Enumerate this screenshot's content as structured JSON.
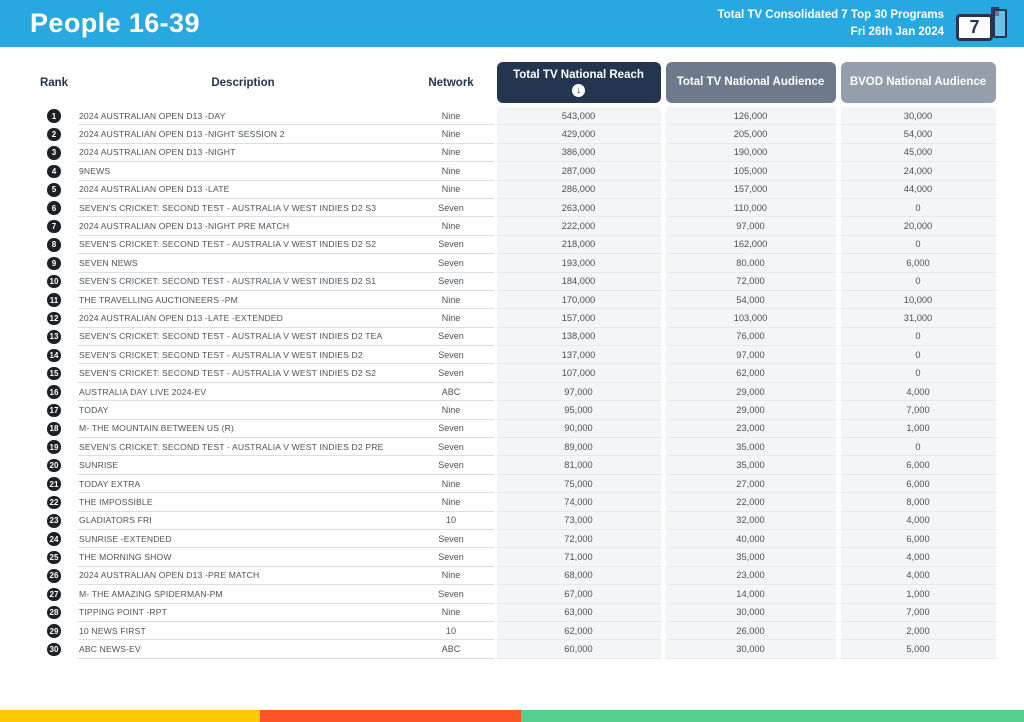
{
  "page": {
    "accent_blue": "#27A8E0",
    "navy": "#24354F"
  },
  "header": {
    "title": "People 16-39",
    "subtitle_line1": "Total TV Consolidated 7 Top 30 Programs",
    "subtitle_line2": "Fri 26th Jan 2024",
    "logo_number": "7"
  },
  "icons": {
    "sort_descending": "↓"
  },
  "table": {
    "headers": {
      "rank": "Rank",
      "description": "Description",
      "network": "Network",
      "reach": "Total TV National Reach",
      "audience": "Total TV National Audience",
      "bvod": "BVOD National Audience"
    },
    "header_colors": {
      "reach_bg": "#24354F",
      "audience_bg": "#6E7A8C",
      "bvod_bg": "#949EAC"
    },
    "rows": [
      {
        "rank": "1",
        "description": "2024 AUSTRALIAN OPEN D13 -DAY",
        "network": "Nine",
        "reach": "543,000",
        "audience": "126,000",
        "bvod": "30,000"
      },
      {
        "rank": "2",
        "description": "2024 AUSTRALIAN OPEN D13 -NIGHT SESSION 2",
        "network": "Nine",
        "reach": "429,000",
        "audience": "205,000",
        "bvod": "54,000"
      },
      {
        "rank": "3",
        "description": "2024 AUSTRALIAN OPEN D13 -NIGHT",
        "network": "Nine",
        "reach": "386,000",
        "audience": "190,000",
        "bvod": "45,000"
      },
      {
        "rank": "4",
        "description": "9NEWS",
        "network": "Nine",
        "reach": "287,000",
        "audience": "105,000",
        "bvod": "24,000"
      },
      {
        "rank": "5",
        "description": "2024 AUSTRALIAN OPEN D13 -LATE",
        "network": "Nine",
        "reach": "286,000",
        "audience": "157,000",
        "bvod": "44,000"
      },
      {
        "rank": "6",
        "description": "SEVEN'S CRICKET: SECOND TEST - AUSTRALIA V WEST INDIES D2 S3",
        "network": "Seven",
        "reach": "263,000",
        "audience": "110,000",
        "bvod": "0"
      },
      {
        "rank": "7",
        "description": "2024 AUSTRALIAN OPEN D13 -NIGHT PRE MATCH",
        "network": "Nine",
        "reach": "222,000",
        "audience": "97,000",
        "bvod": "20,000"
      },
      {
        "rank": "8",
        "description": "SEVEN'S CRICKET: SECOND TEST - AUSTRALIA V WEST INDIES D2 S2",
        "network": "Seven",
        "reach": "218,000",
        "audience": "162,000",
        "bvod": "0"
      },
      {
        "rank": "9",
        "description": "SEVEN NEWS",
        "network": "Seven",
        "reach": "193,000",
        "audience": "80,000",
        "bvod": "6,000"
      },
      {
        "rank": "10",
        "description": "SEVEN'S CRICKET: SECOND TEST - AUSTRALIA V WEST INDIES D2 S1",
        "network": "Seven",
        "reach": "184,000",
        "audience": "72,000",
        "bvod": "0"
      },
      {
        "rank": "11",
        "description": "THE TRAVELLING AUCTIONEERS -PM",
        "network": "Nine",
        "reach": "170,000",
        "audience": "54,000",
        "bvod": "10,000"
      },
      {
        "rank": "12",
        "description": "2024 AUSTRALIAN OPEN D13 -LATE -EXTENDED",
        "network": "Nine",
        "reach": "157,000",
        "audience": "103,000",
        "bvod": "31,000"
      },
      {
        "rank": "13",
        "description": "SEVEN'S CRICKET: SECOND TEST - AUSTRALIA V WEST INDIES D2 TEA",
        "network": "Seven",
        "reach": "138,000",
        "audience": "76,000",
        "bvod": "0"
      },
      {
        "rank": "14",
        "description": "SEVEN'S CRICKET: SECOND TEST - AUSTRALIA V WEST INDIES D2",
        "network": "Seven",
        "reach": "137,000",
        "audience": "97,000",
        "bvod": "0"
      },
      {
        "rank": "15",
        "description": "SEVEN'S CRICKET: SECOND TEST - AUSTRALIA V WEST INDIES D2 S2",
        "network": "Seven",
        "reach": "107,000",
        "audience": "62,000",
        "bvod": "0"
      },
      {
        "rank": "16",
        "description": "AUSTRALIA DAY LIVE 2024-EV",
        "network": "ABC",
        "reach": "97,000",
        "audience": "29,000",
        "bvod": "4,000"
      },
      {
        "rank": "17",
        "description": "TODAY",
        "network": "Nine",
        "reach": "95,000",
        "audience": "29,000",
        "bvod": "7,000"
      },
      {
        "rank": "18",
        "description": "M- THE MOUNTAIN BETWEEN US (R)",
        "network": "Seven",
        "reach": "90,000",
        "audience": "23,000",
        "bvod": "1,000"
      },
      {
        "rank": "19",
        "description": "SEVEN'S CRICKET: SECOND TEST - AUSTRALIA V WEST INDIES D2 PRE",
        "network": "Seven",
        "reach": "89,000",
        "audience": "35,000",
        "bvod": "0"
      },
      {
        "rank": "20",
        "description": "SUNRISE",
        "network": "Seven",
        "reach": "81,000",
        "audience": "35,000",
        "bvod": "6,000"
      },
      {
        "rank": "21",
        "description": "TODAY EXTRA",
        "network": "Nine",
        "reach": "75,000",
        "audience": "27,000",
        "bvod": "6,000"
      },
      {
        "rank": "22",
        "description": "THE IMPOSSIBLE",
        "network": "Nine",
        "reach": "74,000",
        "audience": "22,000",
        "bvod": "8,000"
      },
      {
        "rank": "23",
        "description": "GLADIATORS FRI",
        "network": "10",
        "reach": "73,000",
        "audience": "32,000",
        "bvod": "4,000"
      },
      {
        "rank": "24",
        "description": "SUNRISE -EXTENDED",
        "network": "Seven",
        "reach": "72,000",
        "audience": "40,000",
        "bvod": "6,000"
      },
      {
        "rank": "25",
        "description": "THE MORNING SHOW",
        "network": "Seven",
        "reach": "71,000",
        "audience": "35,000",
        "bvod": "4,000"
      },
      {
        "rank": "26",
        "description": "2024 AUSTRALIAN OPEN D13 -PRE MATCH",
        "network": "Nine",
        "reach": "68,000",
        "audience": "23,000",
        "bvod": "4,000"
      },
      {
        "rank": "27",
        "description": "M- THE AMAZING SPIDERMAN-PM",
        "network": "Seven",
        "reach": "67,000",
        "audience": "14,000",
        "bvod": "1,000"
      },
      {
        "rank": "28",
        "description": "TIPPING POINT -RPT",
        "network": "Nine",
        "reach": "63,000",
        "audience": "30,000",
        "bvod": "7,000"
      },
      {
        "rank": "29",
        "description": "10 NEWS FIRST",
        "network": "10",
        "reach": "62,000",
        "audience": "26,000",
        "bvod": "2,000"
      },
      {
        "rank": "30",
        "description": "ABC NEWS-EV",
        "network": "ABC",
        "reach": "60,000",
        "audience": "30,000",
        "bvod": "5,000"
      }
    ]
  },
  "footer": {
    "segments": [
      {
        "name": "yellow",
        "color": "#FFC907"
      },
      {
        "name": "orange",
        "color": "#FB5426"
      },
      {
        "name": "green",
        "color": "#57CE8B"
      }
    ]
  }
}
